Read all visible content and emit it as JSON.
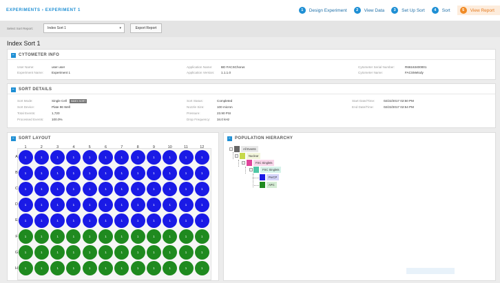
{
  "breadcrumb": {
    "experiments": "EXPERIMENTS",
    "sep": "›",
    "current": "EXPERIMENT 1"
  },
  "steps": [
    {
      "num": "1",
      "label": "Design Experiment"
    },
    {
      "num": "2",
      "label": "View Data"
    },
    {
      "num": "3",
      "label": "Set Up Sort"
    },
    {
      "num": "4",
      "label": "Sort"
    },
    {
      "num": "5",
      "label": "View Report"
    }
  ],
  "toolbar": {
    "select_label": "Select Sort Report:",
    "select_value": "Index Sort 1",
    "caret": "▾",
    "export_label": "Export Report"
  },
  "page_title": "Index Sort 1",
  "cytometer": {
    "title": "CYTOMETER INFO",
    "fields": [
      {
        "k": "User Name:",
        "v": "user user"
      },
      {
        "k": "Experiment Name:",
        "v": "Experiment 1"
      },
      {
        "k": "Application Name:",
        "v": "BD FACSChorus"
      },
      {
        "k": "Application Version:",
        "v": "1.1.1.0"
      },
      {
        "k": "Cytometer Serial Number:",
        "v": "R66163400001"
      },
      {
        "k": "Cytometer Name:",
        "v": "FACSMelody"
      }
    ]
  },
  "sort_details": {
    "title": "SORT DETAILS",
    "badge": "INDEX SORT",
    "fields": [
      {
        "k": "Sort Mode:",
        "v": "Single Cell"
      },
      {
        "k": "Sort Device:",
        "v": "Plate 96 Well"
      },
      {
        "k": "Total Events:",
        "v": "1,720"
      },
      {
        "k": "Processed Events:",
        "v": "100.0%"
      },
      {
        "k": "Sort Status:",
        "v": "Completed"
      },
      {
        "k": "Nozzle Size:",
        "v": "100 micron"
      },
      {
        "k": "Pressure:",
        "v": "23.90 PSI"
      },
      {
        "k": "Drop Frequency:",
        "v": "34.0 kHz"
      },
      {
        "k": "Start Date/Time:",
        "v": "02/22/2017 02:50 PM"
      },
      {
        "k": "End Date/Time:",
        "v": "02/22/2017 02:54 PM"
      }
    ]
  },
  "sort_layout": {
    "title": "SORT LAYOUT",
    "columns": [
      "1",
      "2",
      "3",
      "4",
      "5",
      "6",
      "7",
      "8",
      "9",
      "10",
      "11",
      "12"
    ],
    "rows": [
      "A",
      "B",
      "C",
      "D",
      "E",
      "F",
      "G",
      "H"
    ],
    "well_count": "1",
    "row_colors": [
      "#1a1ae6",
      "#1a1ae6",
      "#1a1ae6",
      "#1a1ae6",
      "#1a1ae6",
      "#1f8a1f",
      "#1f8a1f",
      "#1f8a1f"
    ]
  },
  "population": {
    "title": "POPULATION HIERARCHY",
    "nodes": [
      {
        "label": "All Events",
        "color": "#666666"
      },
      {
        "label": "Nuclear",
        "color": "#c6d94a"
      },
      {
        "label": "FSC Singlets",
        "color": "#e0449b"
      },
      {
        "label": "FSC Singlets",
        "color": "#4fc7a6"
      },
      {
        "label": "PerCP",
        "color": "#1a1ae6"
      },
      {
        "label": "APC",
        "color": "#1f8a1f"
      }
    ]
  }
}
